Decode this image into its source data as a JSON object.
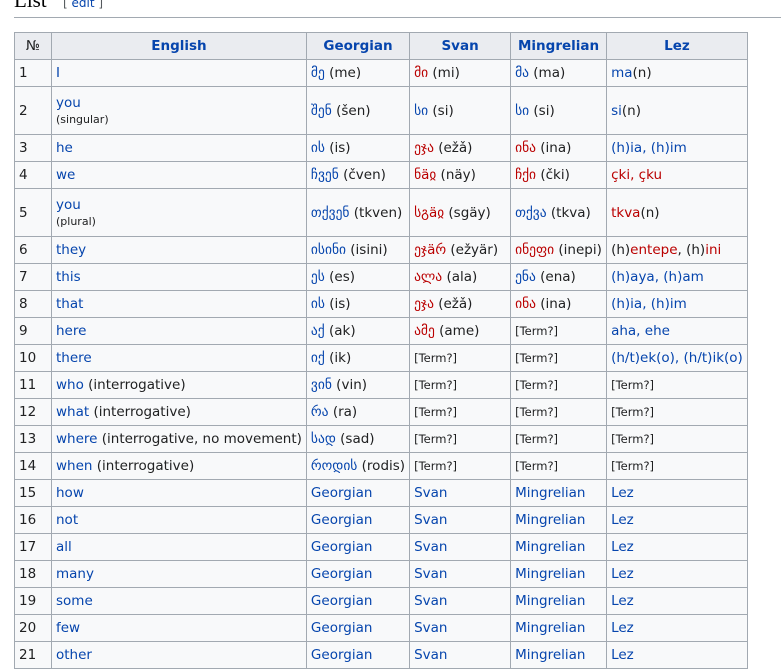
{
  "section": {
    "title": "List",
    "edit_open": "[",
    "edit_label": "edit",
    "edit_close": "]"
  },
  "table": {
    "headers": [
      "№",
      "English",
      "Georgian",
      "Svan",
      "Mingrelian",
      "Lez"
    ],
    "rows": [
      {
        "n": "1",
        "en": [
          {
            "t": "I",
            "c": "blue"
          }
        ],
        "ka": [
          {
            "t": "მე",
            "c": "blue"
          },
          {
            "t": " (me)",
            "c": "plain"
          }
        ],
        "sv": [
          {
            "t": "მი",
            "c": "red"
          },
          {
            "t": " (mi)",
            "c": "plain"
          }
        ],
        "xmf": [
          {
            "t": "მა",
            "c": "blue"
          },
          {
            "t": " (ma)",
            "c": "plain"
          }
        ],
        "lez": [
          {
            "t": "ma",
            "c": "blue"
          },
          {
            "t": "(n)",
            "c": "plain"
          }
        ]
      },
      {
        "n": "2",
        "tall": true,
        "en": [
          {
            "t": "you",
            "c": "blue"
          }
        ],
        "en_sub": "(singular)",
        "ka": [
          {
            "t": "შენ",
            "c": "blue"
          },
          {
            "t": " (šen)",
            "c": "plain"
          }
        ],
        "sv": [
          {
            "t": "სი",
            "c": "blue"
          },
          {
            "t": " (si)",
            "c": "plain"
          }
        ],
        "xmf": [
          {
            "t": "სი",
            "c": "blue"
          },
          {
            "t": " (si)",
            "c": "plain"
          }
        ],
        "lez": [
          {
            "t": "si",
            "c": "blue"
          },
          {
            "t": "(n)",
            "c": "plain"
          }
        ]
      },
      {
        "n": "3",
        "en": [
          {
            "t": "he",
            "c": "blue"
          }
        ],
        "ka": [
          {
            "t": "ის",
            "c": "blue"
          },
          {
            "t": " (is)",
            "c": "plain"
          }
        ],
        "sv": [
          {
            "t": "ეჯა",
            "c": "red"
          },
          {
            "t": " (ežǎ)",
            "c": "plain"
          }
        ],
        "xmf": [
          {
            "t": "ინა",
            "c": "red"
          },
          {
            "t": " (ina)",
            "c": "plain"
          }
        ],
        "lez": [
          {
            "t": "(h)ia, (h)im",
            "c": "blue"
          }
        ]
      },
      {
        "n": "4",
        "en": [
          {
            "t": "we",
            "c": "blue"
          }
        ],
        "ka": [
          {
            "t": "ჩვენ",
            "c": "blue"
          },
          {
            "t": " (čven)",
            "c": "plain"
          }
        ],
        "sv": [
          {
            "t": "ნäჲ",
            "c": "red"
          },
          {
            "t": " (näy)",
            "c": "plain"
          }
        ],
        "xmf": [
          {
            "t": "ჩქი",
            "c": "red"
          },
          {
            "t": " (čki)",
            "c": "plain"
          }
        ],
        "lez": [
          {
            "t": "çki, çku",
            "c": "red"
          }
        ]
      },
      {
        "n": "5",
        "tall": true,
        "en": [
          {
            "t": "you",
            "c": "blue"
          }
        ],
        "en_sub": "(plural)",
        "ka": [
          {
            "t": "თქვენ",
            "c": "blue"
          },
          {
            "t": " (tkven)",
            "c": "plain"
          }
        ],
        "sv": [
          {
            "t": "სგäჲ",
            "c": "red"
          },
          {
            "t": " (sgäy)",
            "c": "plain"
          }
        ],
        "xmf": [
          {
            "t": "თქვა",
            "c": "blue"
          },
          {
            "t": " (tkva)",
            "c": "plain"
          }
        ],
        "lez": [
          {
            "t": "tkva",
            "c": "red"
          },
          {
            "t": "(n)",
            "c": "plain"
          }
        ]
      },
      {
        "n": "6",
        "en": [
          {
            "t": "they",
            "c": "blue"
          }
        ],
        "ka": [
          {
            "t": "ისინი",
            "c": "blue"
          },
          {
            "t": " (isini)",
            "c": "plain"
          }
        ],
        "sv": [
          {
            "t": "ეჯäრ",
            "c": "red"
          },
          {
            "t": " (ežyär)",
            "c": "plain"
          }
        ],
        "xmf": [
          {
            "t": "ინეფი",
            "c": "red"
          },
          {
            "t": " (inepi)",
            "c": "plain"
          }
        ],
        "lez": [
          {
            "t": "(h)",
            "c": "plain"
          },
          {
            "t": "entepe",
            "c": "red"
          },
          {
            "t": ", (h)",
            "c": "plain"
          },
          {
            "t": "ini",
            "c": "red"
          }
        ]
      },
      {
        "n": "7",
        "en": [
          {
            "t": "this",
            "c": "blue"
          }
        ],
        "ka": [
          {
            "t": "ეს",
            "c": "blue"
          },
          {
            "t": " (es)",
            "c": "plain"
          }
        ],
        "sv": [
          {
            "t": "ალა",
            "c": "red"
          },
          {
            "t": " (ala)",
            "c": "plain"
          }
        ],
        "xmf": [
          {
            "t": "ენა",
            "c": "blue"
          },
          {
            "t": " (ena)",
            "c": "plain"
          }
        ],
        "lez": [
          {
            "t": "(h)aya, (h)am",
            "c": "blue"
          }
        ]
      },
      {
        "n": "8",
        "en": [
          {
            "t": "that",
            "c": "blue"
          }
        ],
        "ka": [
          {
            "t": "ის",
            "c": "blue"
          },
          {
            "t": " (is)",
            "c": "plain"
          }
        ],
        "sv": [
          {
            "t": "ეჯა",
            "c": "red"
          },
          {
            "t": " (ežǎ)",
            "c": "plain"
          }
        ],
        "xmf": [
          {
            "t": "ინა",
            "c": "red"
          },
          {
            "t": " (ina)",
            "c": "plain"
          }
        ],
        "lez": [
          {
            "t": "(h)ia, (h)im",
            "c": "blue"
          }
        ]
      },
      {
        "n": "9",
        "en": [
          {
            "t": "here",
            "c": "blue"
          }
        ],
        "ka": [
          {
            "t": "აქ",
            "c": "blue"
          },
          {
            "t": " (ak)",
            "c": "plain"
          }
        ],
        "sv": [
          {
            "t": "ამე",
            "c": "red"
          },
          {
            "t": " (ame)",
            "c": "plain"
          }
        ],
        "xmf": [
          {
            "t": "[Term?]",
            "c": "note"
          }
        ],
        "lez": [
          {
            "t": "aha, ehe",
            "c": "blue"
          }
        ]
      },
      {
        "n": "10",
        "en": [
          {
            "t": "there",
            "c": "blue"
          }
        ],
        "ka": [
          {
            "t": "იქ",
            "c": "blue"
          },
          {
            "t": " (ik)",
            "c": "plain"
          }
        ],
        "sv": [
          {
            "t": "[Term?]",
            "c": "note"
          }
        ],
        "xmf": [
          {
            "t": "[Term?]",
            "c": "note"
          }
        ],
        "lez": [
          {
            "t": "(h/t)ek(o), (h/t)ik(o)",
            "c": "blue"
          }
        ]
      },
      {
        "n": "11",
        "en": [
          {
            "t": "who",
            "c": "blue"
          },
          {
            "t": " (interrogative)",
            "c": "plain"
          }
        ],
        "ka": [
          {
            "t": "ვინ",
            "c": "blue"
          },
          {
            "t": " (vin)",
            "c": "plain"
          }
        ],
        "sv": [
          {
            "t": "[Term?]",
            "c": "note"
          }
        ],
        "xmf": [
          {
            "t": "[Term?]",
            "c": "note"
          }
        ],
        "lez": [
          {
            "t": "[Term?]",
            "c": "note"
          }
        ]
      },
      {
        "n": "12",
        "en": [
          {
            "t": "what",
            "c": "blue"
          },
          {
            "t": " (interrogative)",
            "c": "plain"
          }
        ],
        "ka": [
          {
            "t": "რა",
            "c": "blue"
          },
          {
            "t": " (ra)",
            "c": "plain"
          }
        ],
        "sv": [
          {
            "t": "[Term?]",
            "c": "note"
          }
        ],
        "xmf": [
          {
            "t": "[Term?]",
            "c": "note"
          }
        ],
        "lez": [
          {
            "t": "[Term?]",
            "c": "note"
          }
        ]
      },
      {
        "n": "13",
        "en": [
          {
            "t": "where",
            "c": "blue"
          },
          {
            "t": " (interrogative, no movement)",
            "c": "plain"
          }
        ],
        "ka": [
          {
            "t": "სად",
            "c": "blue"
          },
          {
            "t": " (sad)",
            "c": "plain"
          }
        ],
        "sv": [
          {
            "t": "[Term?]",
            "c": "note"
          }
        ],
        "xmf": [
          {
            "t": "[Term?]",
            "c": "note"
          }
        ],
        "lez": [
          {
            "t": "[Term?]",
            "c": "note"
          }
        ]
      },
      {
        "n": "14",
        "en": [
          {
            "t": "when",
            "c": "blue"
          },
          {
            "t": " (interrogative)",
            "c": "plain"
          }
        ],
        "ka": [
          {
            "t": "როდის",
            "c": "blue"
          },
          {
            "t": " (rodis)",
            "c": "plain"
          }
        ],
        "sv": [
          {
            "t": "[Term?]",
            "c": "note"
          }
        ],
        "xmf": [
          {
            "t": "[Term?]",
            "c": "note"
          }
        ],
        "lez": [
          {
            "t": "[Term?]",
            "c": "note"
          }
        ]
      },
      {
        "n": "15",
        "en": [
          {
            "t": "how",
            "c": "blue"
          }
        ],
        "ka": [
          {
            "t": "Georgian",
            "c": "blue"
          }
        ],
        "sv": [
          {
            "t": "Svan",
            "c": "blue"
          }
        ],
        "xmf": [
          {
            "t": "Mingrelian",
            "c": "blue"
          }
        ],
        "lez": [
          {
            "t": "Lez",
            "c": "blue"
          }
        ]
      },
      {
        "n": "16",
        "en": [
          {
            "t": "not",
            "c": "blue"
          }
        ],
        "ka": [
          {
            "t": "Georgian",
            "c": "blue"
          }
        ],
        "sv": [
          {
            "t": "Svan",
            "c": "blue"
          }
        ],
        "xmf": [
          {
            "t": "Mingrelian",
            "c": "blue"
          }
        ],
        "lez": [
          {
            "t": "Lez",
            "c": "blue"
          }
        ]
      },
      {
        "n": "17",
        "en": [
          {
            "t": "all",
            "c": "blue"
          }
        ],
        "ka": [
          {
            "t": "Georgian",
            "c": "blue"
          }
        ],
        "sv": [
          {
            "t": "Svan",
            "c": "blue"
          }
        ],
        "xmf": [
          {
            "t": "Mingrelian",
            "c": "blue"
          }
        ],
        "lez": [
          {
            "t": "Lez",
            "c": "blue"
          }
        ]
      },
      {
        "n": "18",
        "en": [
          {
            "t": "many",
            "c": "blue"
          }
        ],
        "ka": [
          {
            "t": "Georgian",
            "c": "blue"
          }
        ],
        "sv": [
          {
            "t": "Svan",
            "c": "blue"
          }
        ],
        "xmf": [
          {
            "t": "Mingrelian",
            "c": "blue"
          }
        ],
        "lez": [
          {
            "t": "Lez",
            "c": "blue"
          }
        ]
      },
      {
        "n": "19",
        "en": [
          {
            "t": "some",
            "c": "blue"
          }
        ],
        "ka": [
          {
            "t": "Georgian",
            "c": "blue"
          }
        ],
        "sv": [
          {
            "t": "Svan",
            "c": "blue"
          }
        ],
        "xmf": [
          {
            "t": "Mingrelian",
            "c": "blue"
          }
        ],
        "lez": [
          {
            "t": "Lez",
            "c": "blue"
          }
        ]
      },
      {
        "n": "20",
        "en": [
          {
            "t": "few",
            "c": "blue"
          }
        ],
        "ka": [
          {
            "t": "Georgian",
            "c": "blue"
          }
        ],
        "sv": [
          {
            "t": "Svan",
            "c": "blue"
          }
        ],
        "xmf": [
          {
            "t": "Mingrelian",
            "c": "blue"
          }
        ],
        "lez": [
          {
            "t": "Lez",
            "c": "blue"
          }
        ]
      },
      {
        "n": "21",
        "en": [
          {
            "t": "other",
            "c": "blue"
          }
        ],
        "ka": [
          {
            "t": "Georgian",
            "c": "blue"
          }
        ],
        "sv": [
          {
            "t": "Svan",
            "c": "blue"
          }
        ],
        "xmf": [
          {
            "t": "Mingrelian",
            "c": "blue"
          }
        ],
        "lez": [
          {
            "t": "Lez",
            "c": "blue"
          }
        ]
      }
    ]
  },
  "colors": {
    "link": "#0645ad",
    "redlink": "#ba0000",
    "border": "#a2a9b1",
    "header_bg": "#eaecf0",
    "cell_bg": "#f8f9fa"
  }
}
